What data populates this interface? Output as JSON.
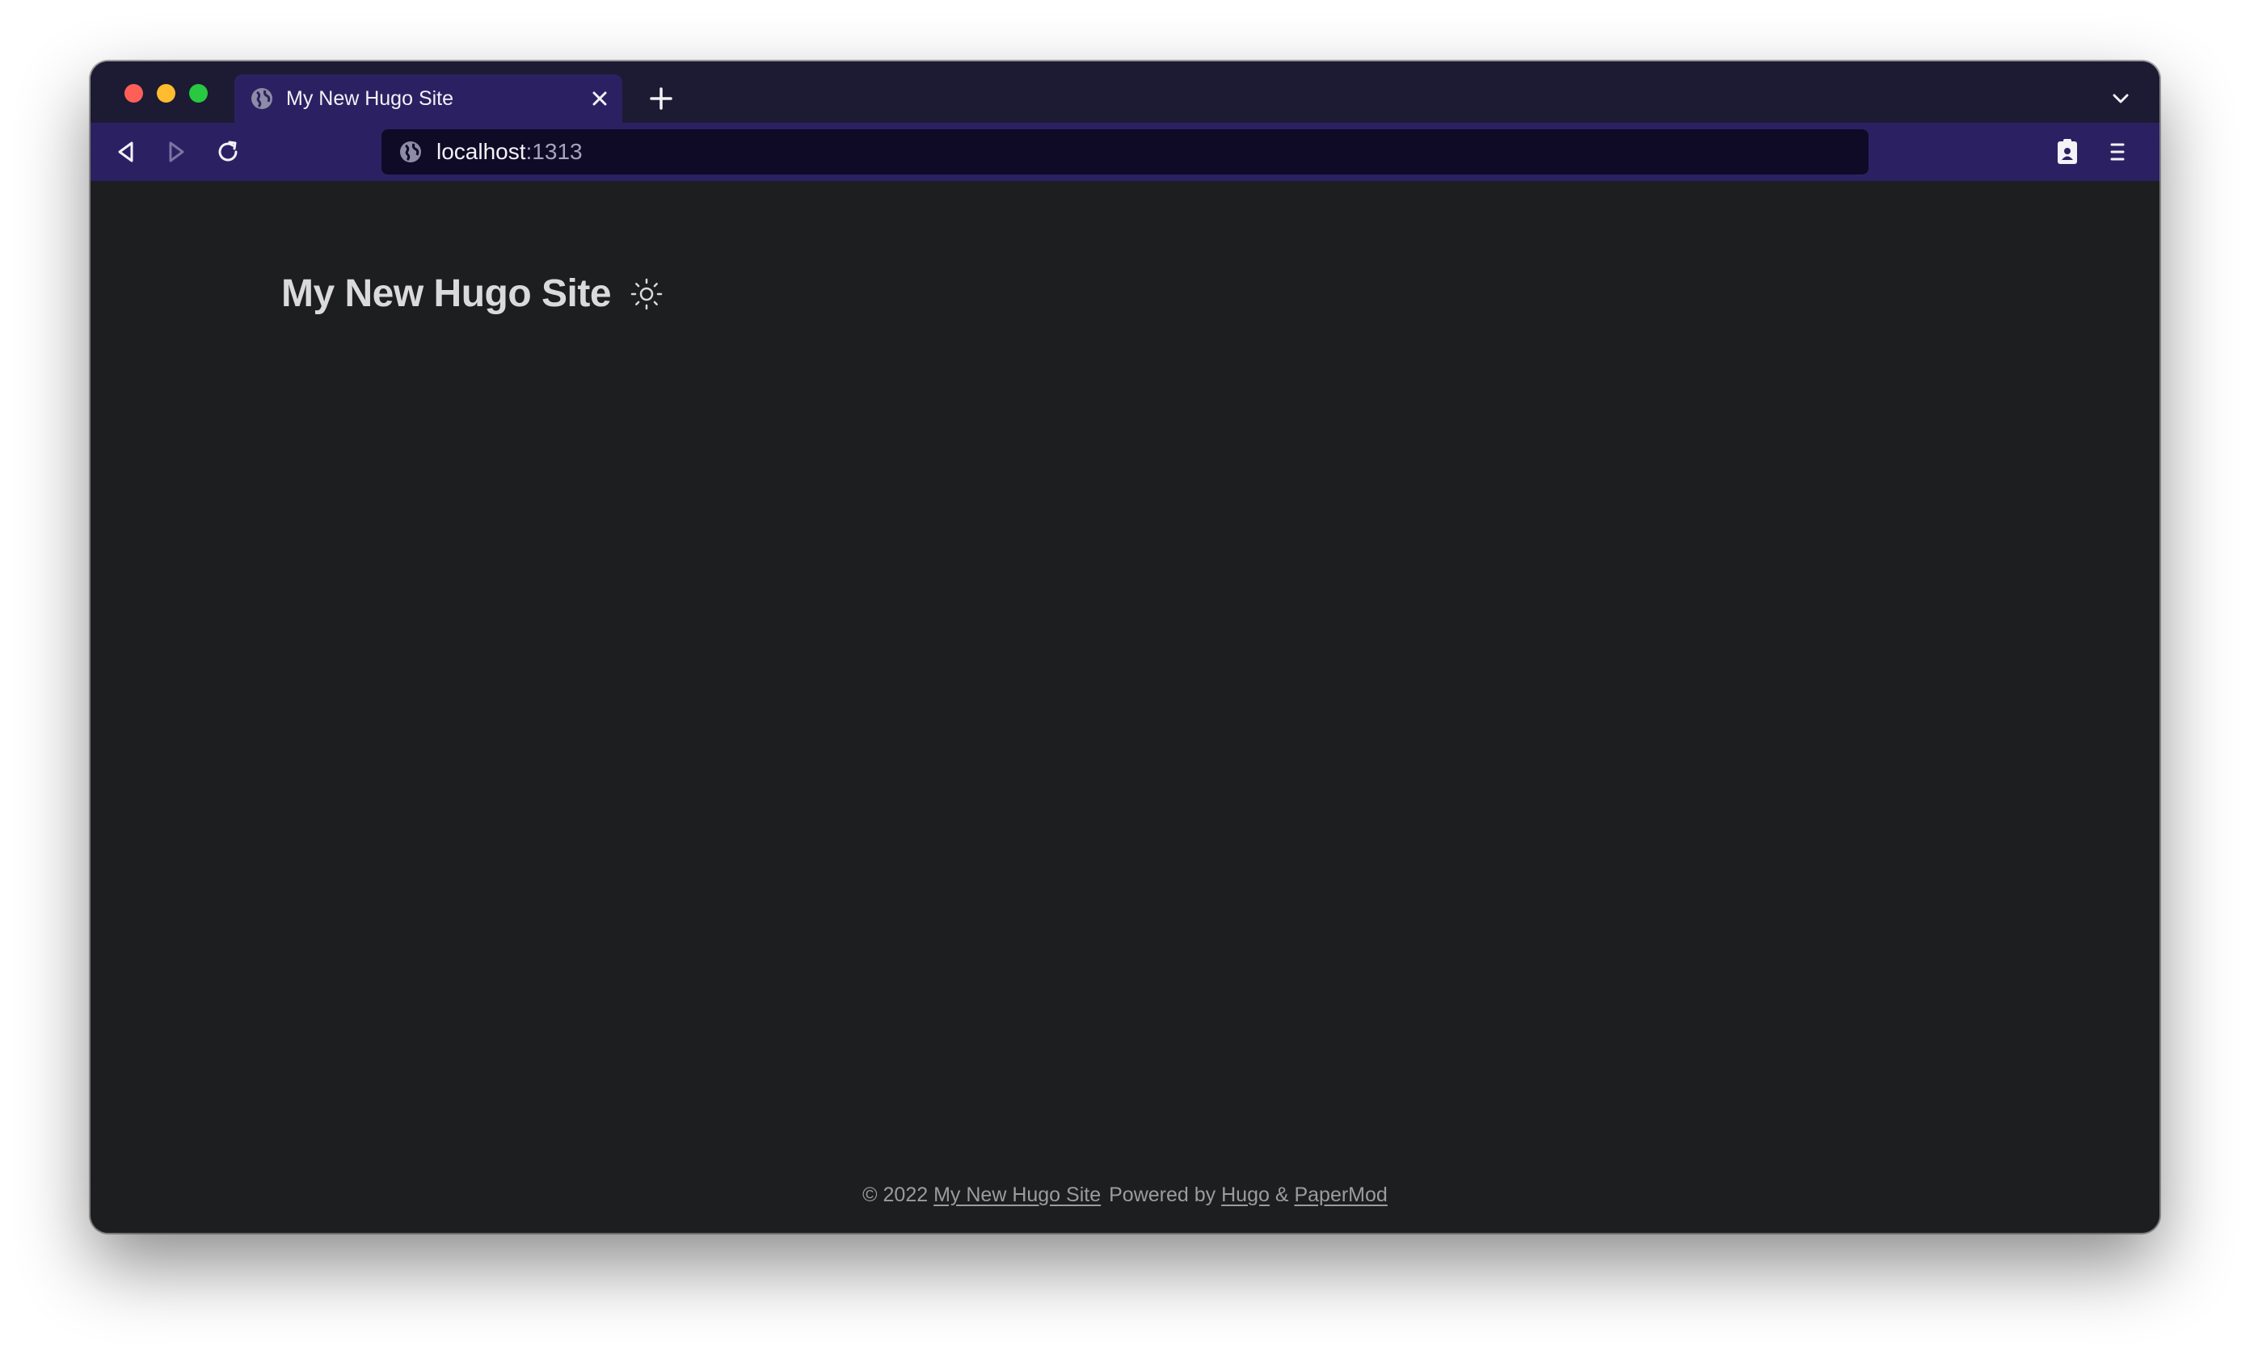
{
  "browser": {
    "tab": {
      "title": "My New Hugo Site"
    },
    "address": {
      "host": "localhost",
      "port": ":1313"
    },
    "icons": {
      "tab_favicon": "globe-icon",
      "tab_close": "close-icon",
      "new_tab": "plus-icon",
      "list_tabs": "chevron-down-icon",
      "back": "back-arrow-icon",
      "forward": "forward-arrow-icon",
      "reload": "reload-icon",
      "site_info": "globe-icon",
      "account": "account-badge-icon",
      "menu": "hamburger-menu-icon"
    },
    "colors": {
      "tabstrip": "#1c1b33",
      "toolbar": "#2b2162",
      "urlbar": "#0f0b26"
    }
  },
  "page": {
    "site_title": "My New Hugo Site",
    "theme_toggle_icon": "sun-icon",
    "footer": {
      "copyright": "© 2022",
      "site_link": "My New Hugo Site",
      "powered_by": "Powered by",
      "hugo_link": "Hugo",
      "ampersand": "&",
      "theme_link": "PaperMod"
    },
    "colors": {
      "background": "#1d1e20",
      "title_text": "#dadadb",
      "footer_text": "#9b9c9d"
    }
  }
}
